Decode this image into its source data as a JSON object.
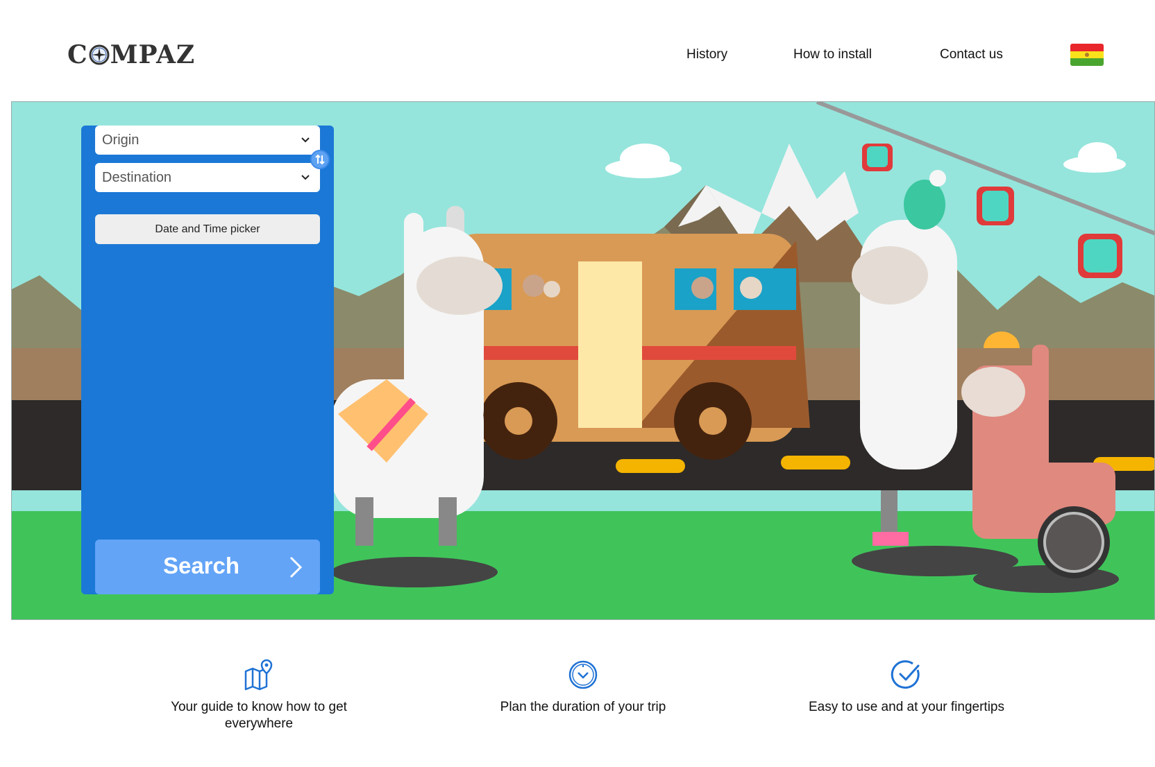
{
  "brand": {
    "logo_text_before": "C",
    "logo_text_after": "MPAZ"
  },
  "nav": {
    "history": "History",
    "how_to_install": "How to install",
    "contact": "Contact us"
  },
  "language_flag": {
    "colors": [
      "#e8262b",
      "#f9e21c",
      "#4aa52f"
    ]
  },
  "search_form": {
    "origin_placeholder": "Origin",
    "destination_placeholder": "Destination",
    "datetime_label": "Date and Time picker",
    "search_label": "Search"
  },
  "features": [
    {
      "icon": "map-pin-icon",
      "text": "Your guide to know how to get everywhere"
    },
    {
      "icon": "clock-icon",
      "text": "Plan the duration of your trip"
    },
    {
      "icon": "check-circle-icon",
      "text": "Easy to use and at your fingertips"
    }
  ],
  "colors": {
    "accent": "#1b78d6",
    "search_button": "#63a4f7",
    "icon_blue": "#1f72d4"
  }
}
